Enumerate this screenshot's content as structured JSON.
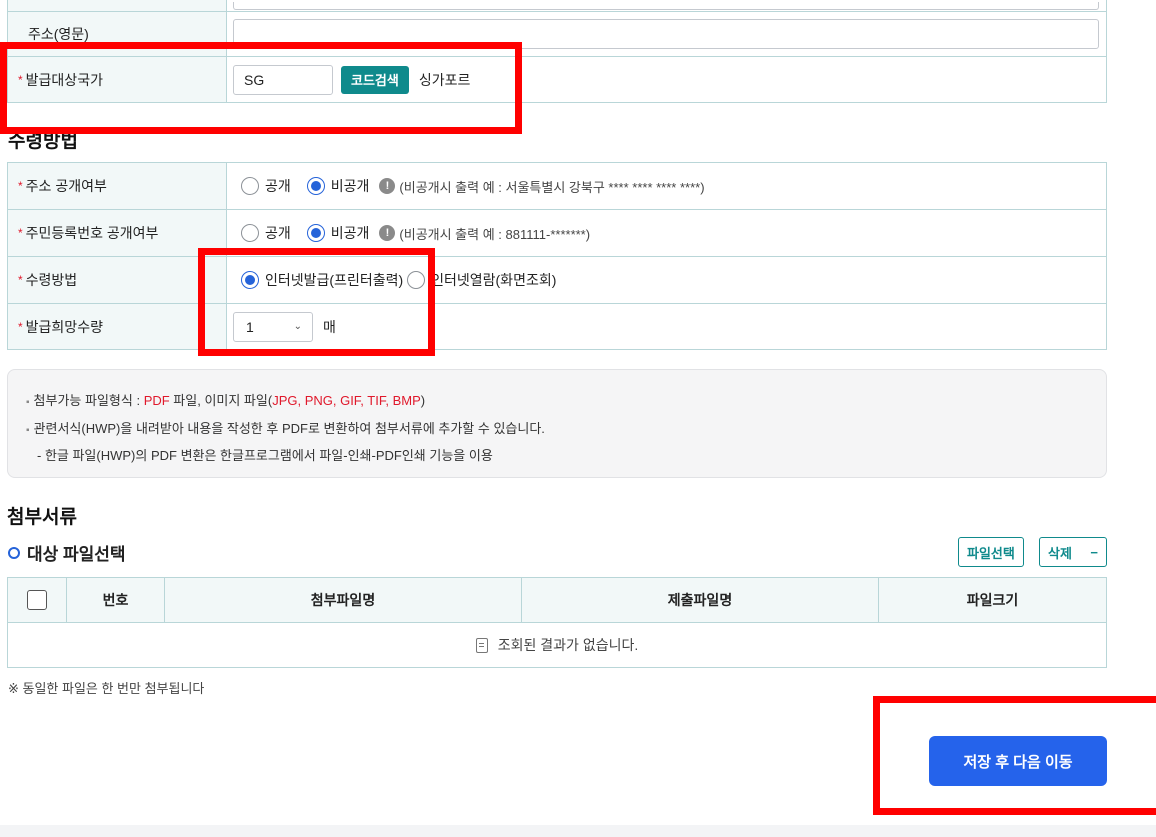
{
  "address_en": {
    "label": "주소(영문)"
  },
  "country": {
    "required": "*",
    "label": "발급대상국가",
    "code_value": "SG",
    "search_button": "코드검색",
    "country_name": "싱가포르"
  },
  "receipt_section": {
    "title": "수령방법"
  },
  "address_public": {
    "required": "*",
    "label": "주소 공개여부",
    "option_public": "공개",
    "option_private": "비공개",
    "selected": "비공개",
    "info_icon": "!",
    "info": "(비공개시 출력 예 : 서울특별시 강북구 **** **** **** ****)"
  },
  "rrn_public": {
    "required": "*",
    "label": "주민등록번호 공개여부",
    "option_public": "공개",
    "option_private": "비공개",
    "selected": "비공개",
    "info_icon": "!",
    "info": "(비공개시 출력 예 : 881111-*******)"
  },
  "receipt_method": {
    "required": "*",
    "label": "수령방법",
    "option_internet_issue": "인터넷발급(프린터출력)",
    "option_internet_view": "인터넷열람(화면조회)",
    "selected": "인터넷발급(프린터출력)"
  },
  "quantity": {
    "required": "*",
    "label": "발급희망수량",
    "value": "1",
    "unit": "매"
  },
  "notice": {
    "bullet": "▪",
    "line1_prefix": "첨부가능 파일형식 : ",
    "line1_pdf": "PDF",
    "line1_mid": " 파일, 이미지 파일(",
    "line1_images": "JPG, PNG, GIF, TIF, BMP",
    "line1_suffix": ")",
    "line2": "관련서식(HWP)을 내려받아 내용을 작성한 후 PDF로 변환하여 첨부서류에 추가할 수 있습니다.",
    "line3": "- 한글 파일(HWP)의 PDF 변환은 한글프로그램에서 파일-인쇄-PDF인쇄 기능을 이용"
  },
  "attachments": {
    "title": "첨부서류",
    "subtitle": "대상 파일선택",
    "select_button": "파일선택",
    "delete_button": "삭제",
    "delete_icon": "−",
    "columns": [
      "번호",
      "첨부파일명",
      "제출파일명",
      "파일크기"
    ],
    "empty_message": "조회된 결과가 없습니다.",
    "note": "※ 동일한 파일은 한 번만 첨부됩니다"
  },
  "submit_button": "저장 후 다음 이동",
  "colors": {
    "accent_teal": "#0f8a8c",
    "primary_blue": "#2563eb",
    "required_red": "#e0182b",
    "highlight_red": "#ff0000"
  }
}
